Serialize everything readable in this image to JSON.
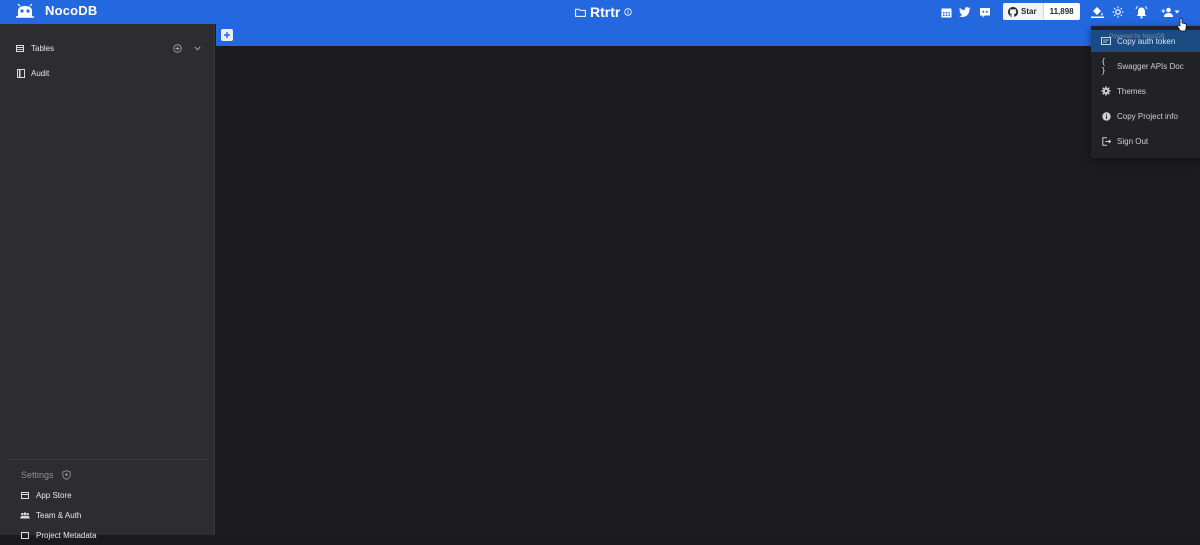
{
  "app": {
    "brand": "NocoDB",
    "project_name": "Rtrtr"
  },
  "topbar": {
    "github": {
      "star_label": "Star",
      "count": "11,898"
    },
    "icons": [
      "calendar-icon",
      "twitter-icon",
      "discord-icon",
      "github-icon",
      "paint-bucket-icon",
      "brightness-icon",
      "bell-icon",
      "user-add-icon",
      "caret-down-icon"
    ],
    "colors": {
      "primary": "#2468e0",
      "menu_highlight": "#1a4b83"
    }
  },
  "sidebar": {
    "tables_label": "Tables",
    "audit_label": "Audit",
    "settings_label": "Settings",
    "settings_items": [
      {
        "label": "App Store",
        "icon": "store-icon"
      },
      {
        "label": "Team & Auth",
        "icon": "team-icon"
      },
      {
        "label": "Project Metadata",
        "icon": "metadata-icon"
      }
    ]
  },
  "user_menu": {
    "powered_by": "Powered by NocoDB",
    "items": [
      {
        "label": "Copy auth token",
        "icon": "token-icon"
      },
      {
        "label": "Swagger APIs Doc",
        "icon": "braces-icon"
      },
      {
        "label": "Themes",
        "icon": "gear-icon"
      },
      {
        "label": "Copy Project info",
        "icon": "info-icon"
      },
      {
        "label": "Sign Out",
        "icon": "sign-out-icon"
      }
    ]
  }
}
